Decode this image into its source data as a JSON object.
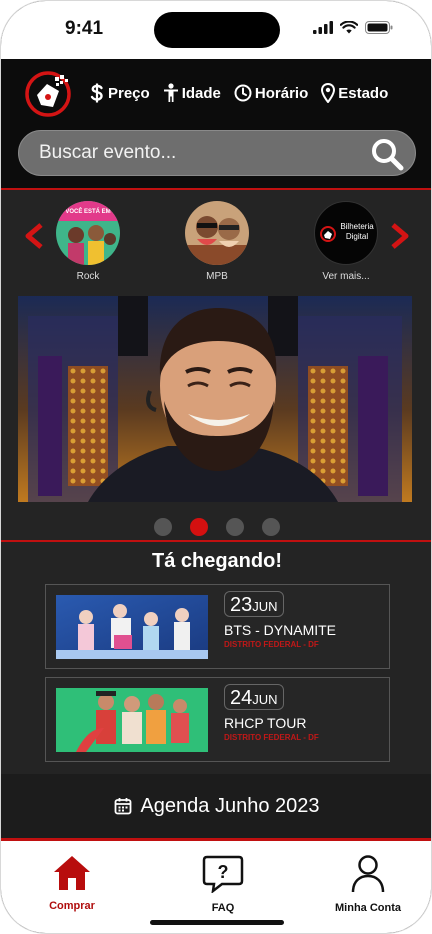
{
  "status_bar": {
    "time": "9:41"
  },
  "header": {
    "filters": [
      {
        "label": "Preço",
        "icon": "dollar-icon"
      },
      {
        "label": "Idade",
        "icon": "person-icon"
      },
      {
        "label": "Horário",
        "icon": "clock-icon"
      },
      {
        "label": "Estado",
        "icon": "location-pin-icon"
      }
    ],
    "search": {
      "placeholder": "Buscar evento..."
    }
  },
  "categories": {
    "items": [
      {
        "label": "Rock",
        "thumb_text": "VOCÊ ESTÁ EM"
      },
      {
        "label": "MPB"
      },
      {
        "label": "Ver mais...",
        "thumb_text": "Bilheteria Digital"
      }
    ]
  },
  "carousel": {
    "pages": 4,
    "active_index": 1
  },
  "coming": {
    "title": "Tá chegando!",
    "events": [
      {
        "day": "23",
        "month": "JUN",
        "name": "BTS - DYNAMITE",
        "location": "DISTRITO FEDERAL - DF"
      },
      {
        "day": "24",
        "month": "JUN",
        "name": "RHCP TOUR",
        "location": "DISTRITO FEDERAL - DF"
      }
    ]
  },
  "agenda": {
    "label": "Agenda Junho 2023"
  },
  "tabbar": {
    "tabs": [
      {
        "label": "Comprar",
        "icon": "home-icon"
      },
      {
        "label": "FAQ",
        "icon": "faq-icon"
      },
      {
        "label": "Minha Conta",
        "icon": "user-icon"
      }
    ]
  },
  "colors": {
    "accent": "#c01010",
    "background": "#242424",
    "header": "#0c0c0c"
  }
}
